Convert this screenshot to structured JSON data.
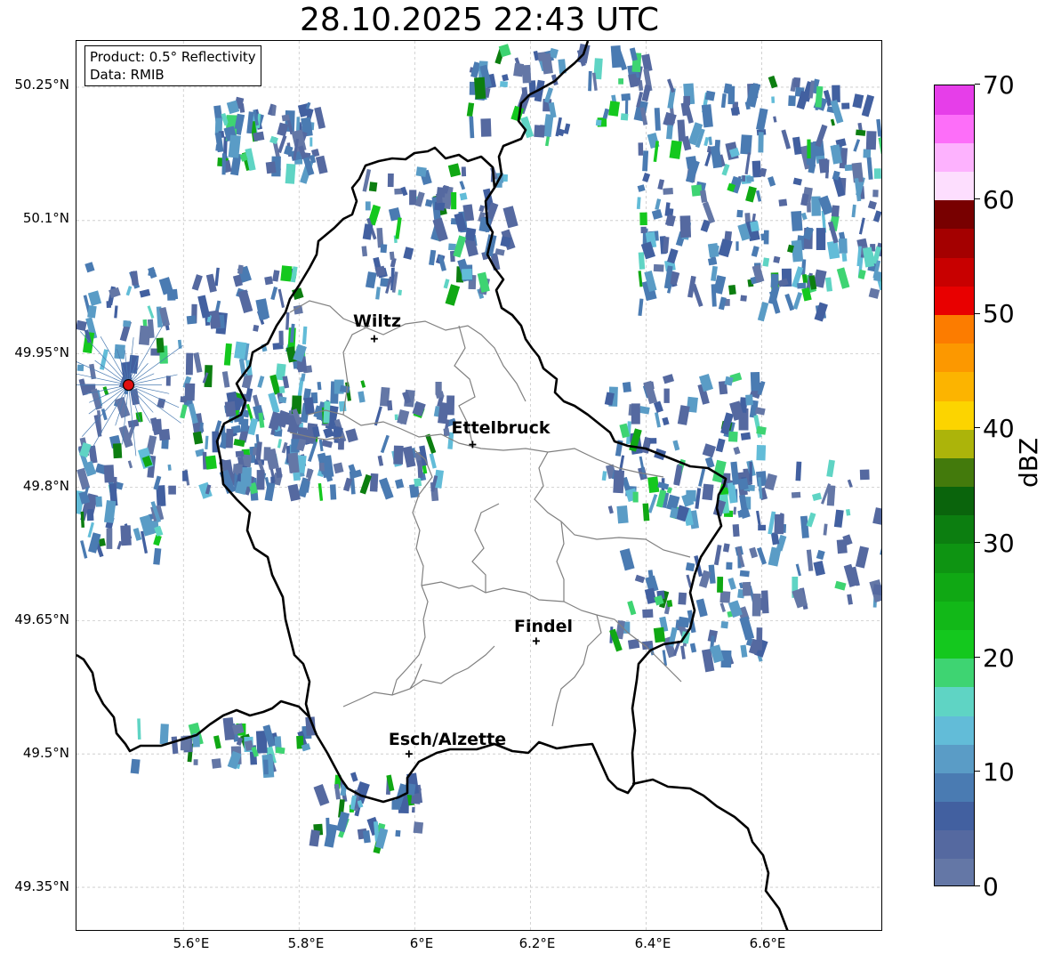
{
  "title": "28.10.2025 22:43 UTC",
  "info": {
    "product_line": "Product: 0.5° Reflectivity",
    "data_line": "Data: RMIB"
  },
  "lat_labels": [
    "50.25°N",
    "50.1°N",
    "49.95°N",
    "49.8°N",
    "49.65°N",
    "49.5°N",
    "49.35°N"
  ],
  "lon_labels": [
    "5.6°E",
    "5.8°E",
    "6°E",
    "6.2°E",
    "6.4°E",
    "6.6°E"
  ],
  "cities": [
    {
      "name": "Wiltz",
      "lon": 5.93,
      "lat": 49.967
    },
    {
      "name": "Ettelbruck",
      "lon": 6.1,
      "lat": 49.848
    },
    {
      "name": "Findel",
      "lon": 6.21,
      "lat": 49.627
    },
    {
      "name": "Esch/Alzette",
      "lon": 5.99,
      "lat": 49.5
    }
  ],
  "radar_site": {
    "lon": 5.505,
    "lat": 49.915
  },
  "colorbar": {
    "unit": "dBZ",
    "tick_labels": [
      "0",
      "10",
      "20",
      "30",
      "40",
      "50",
      "60",
      "70"
    ],
    "colors": [
      "#6477a6",
      "#5569a0",
      "#4260a0",
      "#4a7bb2",
      "#5a9cc6",
      "#62bcd8",
      "#5fd4c4",
      "#3ed472",
      "#14c81e",
      "#12b818",
      "#10a814",
      "#0e9412",
      "#0c7e10",
      "#0a640c",
      "#437a0c",
      "#acb40a",
      "#fcd400",
      "#fcb400",
      "#fc9800",
      "#fc7c00",
      "#e80000",
      "#c80000",
      "#a40000",
      "#780000",
      "#fddefe",
      "#fdb2fe",
      "#fd6ef9",
      "#e63ee9"
    ]
  },
  "bounds": {
    "lon_min": 5.415,
    "lon_max": 6.81,
    "lat_min": 49.3,
    "lat_max": 50.302
  }
}
